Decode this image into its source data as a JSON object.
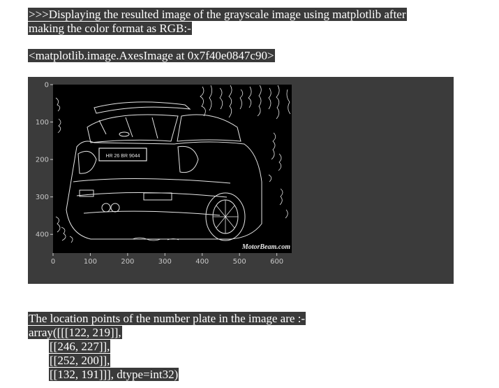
{
  "intro": {
    "line1": ">>>Displaying the resulted image of the grayscale image using matplotlib after",
    "line2": "making the color format as RGB:-"
  },
  "axes_repr": "<matplotlib.image.AxesImage at 0x7f40e0847c90>",
  "plot": {
    "panel_color": "#3b3b3b",
    "image_color": "#000000",
    "edge_color": "#e8e8e8",
    "tick_color": "#c8c8c8",
    "plate_text": "HR 26 BR 9044",
    "watermark": "MotorBeam.com",
    "x_axis": {
      "range": [
        0,
        640
      ],
      "ticks": [
        0,
        100,
        200,
        300,
        400,
        500,
        600
      ]
    },
    "y_axis": {
      "range": [
        0,
        450
      ],
      "ticks": [
        0,
        100,
        200,
        300,
        400
      ]
    }
  },
  "result": {
    "heading": "The location points of the number plate in the image are :-",
    "rows": [
      "array([[[122, 219]],",
      "[[246, 227]],",
      "[[252, 200]],",
      "[[132, 191]]], dtype=int32)"
    ]
  }
}
